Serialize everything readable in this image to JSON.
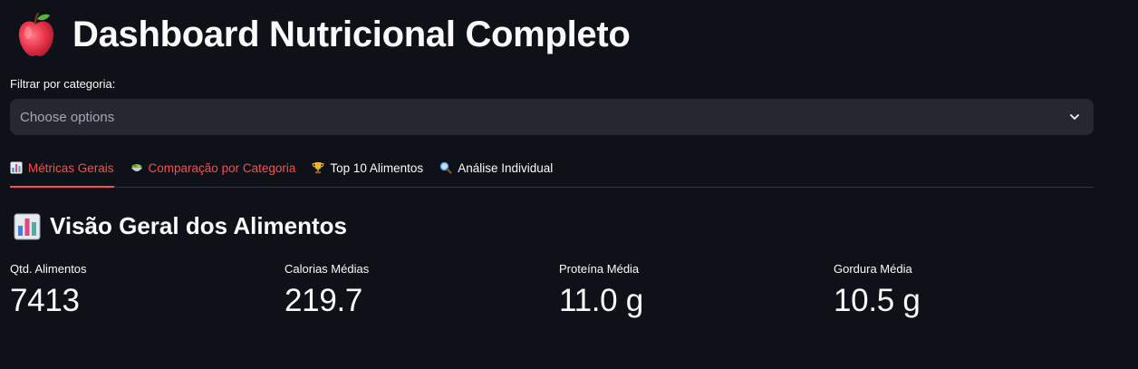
{
  "header": {
    "icon": "red-apple-icon",
    "title": "Dashboard Nutricional Completo"
  },
  "filter": {
    "label": "Filtrar por categoria:",
    "placeholder": "Choose options"
  },
  "tabs": [
    {
      "label": "Métricas Gerais",
      "icon": "bar-chart-icon",
      "active": true
    },
    {
      "label": "Comparação por Categoria",
      "icon": "salad-bowl-icon",
      "active": false
    },
    {
      "label": "Top 10 Alimentos",
      "icon": "trophy-icon",
      "active": false
    },
    {
      "label": "Análise Individual",
      "icon": "magnifier-icon",
      "active": false
    }
  ],
  "section": {
    "icon": "bar-chart-icon",
    "title": "Visão Geral dos Alimentos"
  },
  "metrics": [
    {
      "label": "Qtd. Alimentos",
      "value": "7413"
    },
    {
      "label": "Calorias Médias",
      "value": "219.7"
    },
    {
      "label": "Proteína Média",
      "value": "11.0 g"
    },
    {
      "label": "Gordura Média",
      "value": "10.5 g"
    }
  ],
  "colors": {
    "background": "#0e1117",
    "accent": "#ff4b4b",
    "select_bg": "#262730",
    "text": "#fafafa"
  }
}
